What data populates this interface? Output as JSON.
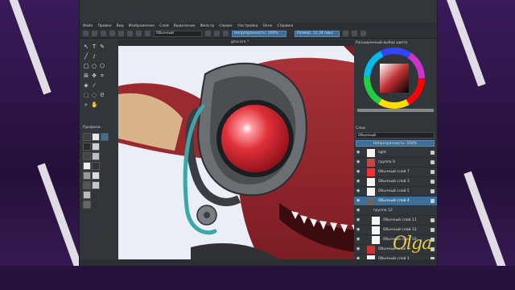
{
  "background": {
    "color": "#2a1340"
  },
  "menu": {
    "items": [
      "Файл",
      "Правка",
      "Вид",
      "Изображение",
      "Слой",
      "Выделение",
      "Фильтр",
      "Сервис",
      "Настройка",
      "Окно",
      "Справка"
    ]
  },
  "toolbar": {
    "blend_mode": "Обычный",
    "opacity_label": "Непрозрачность: 100%",
    "size_label": "Размер: 12,34 пикс"
  },
  "document": {
    "tab_title": "gmo.kra *"
  },
  "toolbox": {
    "presets_title": "Профили..."
  },
  "color_panel": {
    "title": "Расширенный выбор цвета",
    "docker_tab": "Расширенный выбор"
  },
  "layers_panel": {
    "title": "Слои",
    "blend": "Обычный",
    "opacity": "Непрозрачность: 100%",
    "rows": [
      {
        "name": "light",
        "selected": false
      },
      {
        "name": "группа 9",
        "selected": false
      },
      {
        "name": "Обычный слой 7",
        "selected": false
      },
      {
        "name": "Обычный слой 3",
        "selected": false
      },
      {
        "name": "Обычный слой 5",
        "selected": false
      },
      {
        "name": "Обычный слой 4",
        "selected": true
      },
      {
        "name": "группа 12",
        "selected": false
      },
      {
        "name": "Обычный слой 11",
        "selected": false
      },
      {
        "name": "Обычный слой 13",
        "selected": false
      },
      {
        "name": "Обычный слой 10",
        "selected": false
      },
      {
        "name": "Обычный слой 1",
        "selected": false
      },
      {
        "name": "Обычный слой 1",
        "selected": false
      }
    ]
  },
  "watermark": {
    "text": "Olga"
  },
  "colors": {
    "selection": "#3d6e96",
    "panel": "#31363b",
    "accent_red": "#e0303a"
  }
}
